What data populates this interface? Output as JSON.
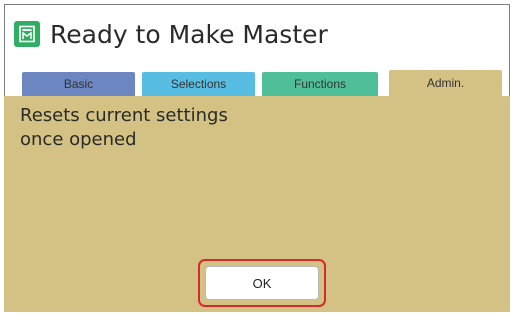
{
  "header": {
    "title": "Ready to Make Master",
    "icon": "master-icon",
    "icon_color": "#2fae63"
  },
  "tabs": [
    {
      "label": "Basic",
      "color": "#6b86c1"
    },
    {
      "label": "Selections",
      "color": "#57bde3"
    },
    {
      "label": "Functions",
      "color": "#4fbf9a"
    },
    {
      "label": "Admin.",
      "color": "#d3c283",
      "active": true
    }
  ],
  "panel": {
    "message_line1": "Resets current settings",
    "message_line2": "once opened",
    "background": "#d3c283"
  },
  "actions": {
    "ok_label": "OK",
    "highlight_color": "#d6282f"
  }
}
